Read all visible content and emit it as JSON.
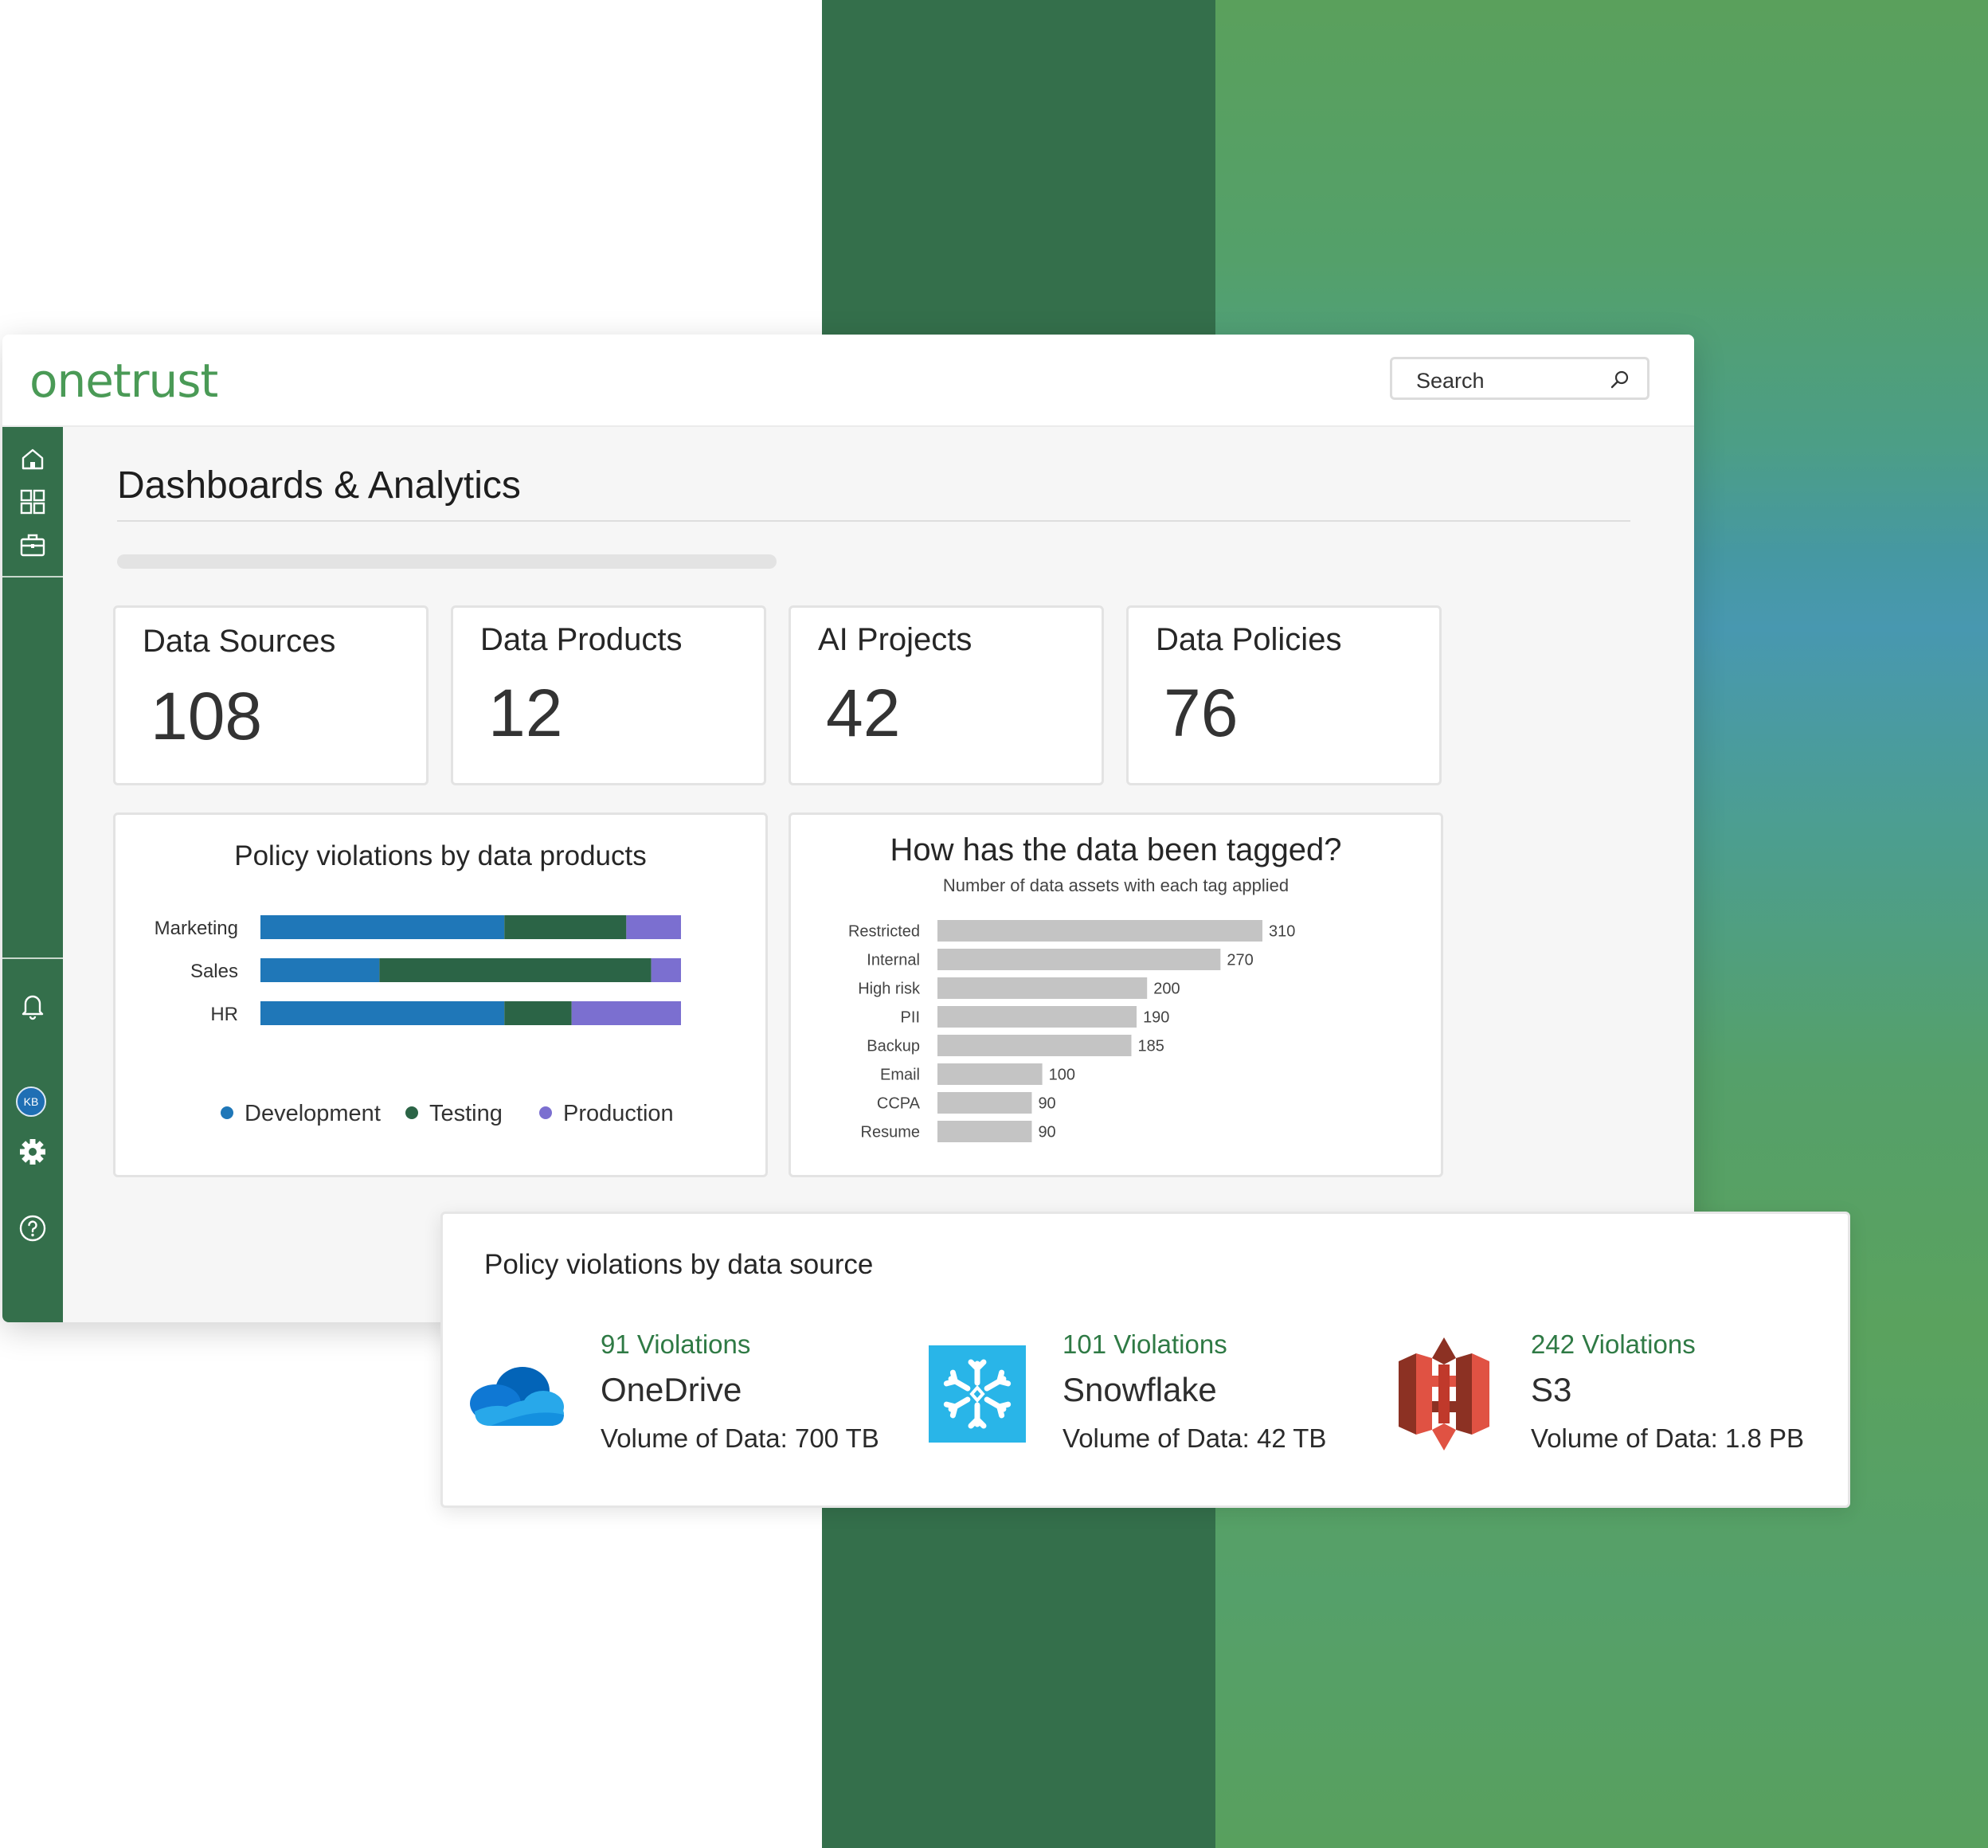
{
  "brand": {
    "logo_text": "onetrust",
    "color": "#4a9a56"
  },
  "search": {
    "placeholder": "Search"
  },
  "sidebar": {
    "top_icons": [
      "home-icon",
      "grid-icon",
      "briefcase-icon"
    ],
    "bottom_icons": [
      "bell-icon",
      "avatar",
      "gear-icon",
      "help-icon"
    ],
    "avatar_initials": "KB",
    "color": "#346f4b"
  },
  "page": {
    "title": "Dashboards & Analytics"
  },
  "stats": [
    {
      "label": "Data Sources",
      "value": "108"
    },
    {
      "label": "Data Products",
      "value": "12"
    },
    {
      "label": "AI Projects",
      "value": "42"
    },
    {
      "label": "Data Policies",
      "value": "76"
    }
  ],
  "violations_chart": {
    "title": "Policy violations by data products",
    "legend": [
      "Development",
      "Testing",
      "Production"
    ]
  },
  "tag_chart": {
    "title": "How has the data been tagged?",
    "subtitle": "Number of data assets with each tag applied"
  },
  "chart_data": [
    {
      "type": "bar",
      "orientation": "horizontal",
      "stacked": true,
      "title": "Policy violations by data products",
      "categories": [
        "Marketing",
        "Sales",
        "HR"
      ],
      "series": [
        {
          "name": "Development",
          "values": [
            58,
            28,
            58
          ],
          "color": "#1f77b8"
        },
        {
          "name": "Testing",
          "values": [
            29,
            64,
            16
          ],
          "color": "#2b6446"
        },
        {
          "name": "Production",
          "values": [
            13,
            7,
            26
          ],
          "color": "#7b6fd0"
        }
      ],
      "legend": "bottom"
    },
    {
      "type": "bar",
      "orientation": "horizontal",
      "title": "How has the data been tagged?",
      "subtitle": "Number of data assets with each tag applied",
      "categories": [
        "Restricted",
        "Internal",
        "High risk",
        "PII",
        "Backup",
        "Email",
        "CCPA",
        "Resume"
      ],
      "values": [
        310,
        270,
        200,
        190,
        185,
        100,
        90,
        90
      ],
      "color": "#c4c4c4"
    }
  ],
  "source_card": {
    "title": "Policy violations by data source",
    "sources": [
      {
        "violations": "91 Violations",
        "name": "OneDrive",
        "volume": "Volume of Data: 700 TB",
        "icon": "onedrive-icon"
      },
      {
        "violations": "101 Violations",
        "name": "Snowflake",
        "volume": "Volume of Data: 42 TB",
        "icon": "snowflake-icon"
      },
      {
        "violations": "242 Violations",
        "name": "S3",
        "volume": "Volume of Data: 1.8 PB",
        "icon": "s3-icon"
      }
    ]
  },
  "colors": {
    "accent_green": "#2f7a45",
    "violation_text": "#2f7a45"
  }
}
